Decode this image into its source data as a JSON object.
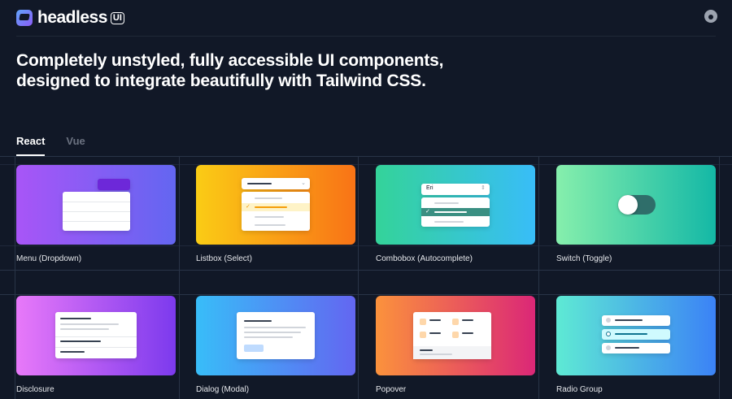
{
  "header": {
    "logo_text": "headless",
    "logo_badge": "UI",
    "github_icon": "github-icon"
  },
  "hero": {
    "headline": "Completely unstyled, fully accessible UI components, designed to integrate beautifully with Tailwind CSS."
  },
  "tabs": [
    {
      "label": "React",
      "active": true
    },
    {
      "label": "Vue",
      "active": false
    }
  ],
  "components": [
    {
      "label": "Menu (Dropdown)",
      "gradient": [
        "#a855f7",
        "#6366f1"
      ]
    },
    {
      "label": "Listbox (Select)",
      "gradient": [
        "#facc15",
        "#f97316"
      ]
    },
    {
      "label": "Combobox (Autocomplete)",
      "gradient": [
        "#34d399",
        "#38bdf8"
      ]
    },
    {
      "label": "Switch (Toggle)",
      "gradient": [
        "#86efac",
        "#14b8a6"
      ]
    },
    {
      "label": "Disclosure",
      "gradient": [
        "#e879f9",
        "#7c3aed"
      ]
    },
    {
      "label": "Dialog (Modal)",
      "gradient": [
        "#38bdf8",
        "#6366f1"
      ]
    },
    {
      "label": "Popover",
      "gradient": [
        "#fb923c",
        "#db2777"
      ]
    },
    {
      "label": "Radio Group",
      "gradient": [
        "#5eead4",
        "#3b82f6"
      ]
    }
  ],
  "combobox_preview": {
    "input_value": "Eri"
  }
}
